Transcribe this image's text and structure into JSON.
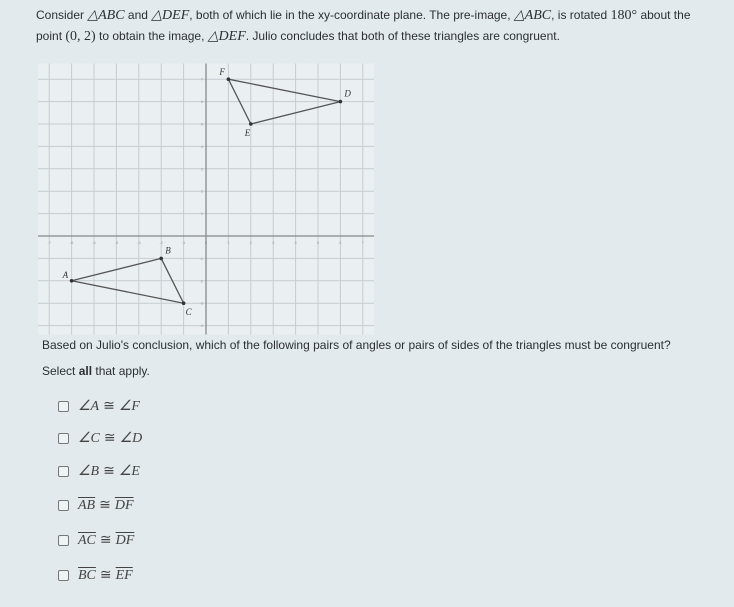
{
  "intro": {
    "t0": "Consider ",
    "m0": "△ABC",
    "t1": " and ",
    "m1": "△DEF",
    "t2": ", both of which lie in the xy-coordinate plane.  The pre-image, ",
    "m2": "△ABC",
    "t3": ", is rotated ",
    "n0": "180°",
    "t4": " about the point ",
    "n1": "(0, 2)",
    "t5": " to obtain the image, ",
    "m3": "△DEF",
    "t6": ".  Julio concludes that both of these triangles are congruent."
  },
  "graph": {
    "x_range": [
      -7,
      7
    ],
    "y_range": [
      -4,
      7
    ],
    "grid": true,
    "points": [
      {
        "label": "A",
        "x": -6,
        "y": -2
      },
      {
        "label": "B",
        "x": -2,
        "y": -1
      },
      {
        "label": "C",
        "x": -1,
        "y": -3
      },
      {
        "label": "D",
        "x": 6,
        "y": 6
      },
      {
        "label": "E",
        "x": 2,
        "y": 5
      },
      {
        "label": "F",
        "x": 1,
        "y": 7
      }
    ],
    "triangles": [
      [
        "A",
        "B",
        "C"
      ],
      [
        "D",
        "E",
        "F"
      ]
    ],
    "line_color": "#555555"
  },
  "question": {
    "line1": "Based on Julio's conclusion, which of the following pairs of angles or pairs of sides of the triangles must be congruent?",
    "line2_pre": "Select ",
    "line2_bold": "all",
    "line2_post": " that apply."
  },
  "options": [
    {
      "left": "∠A",
      "rel": "≅",
      "right": "∠F",
      "segment": false,
      "checked": false
    },
    {
      "left": "∠C",
      "rel": "≅",
      "right": "∠D",
      "segment": false,
      "checked": false
    },
    {
      "left": "∠B",
      "rel": "≅",
      "right": "∠E",
      "segment": false,
      "checked": false
    },
    {
      "left": "AB",
      "rel": "≅",
      "right": "DF",
      "segment": true,
      "checked": false
    },
    {
      "left": "AC",
      "rel": "≅",
      "right": "DF",
      "segment": true,
      "checked": false
    },
    {
      "left": "BC",
      "rel": "≅",
      "right": "EF",
      "segment": true,
      "checked": false
    }
  ]
}
